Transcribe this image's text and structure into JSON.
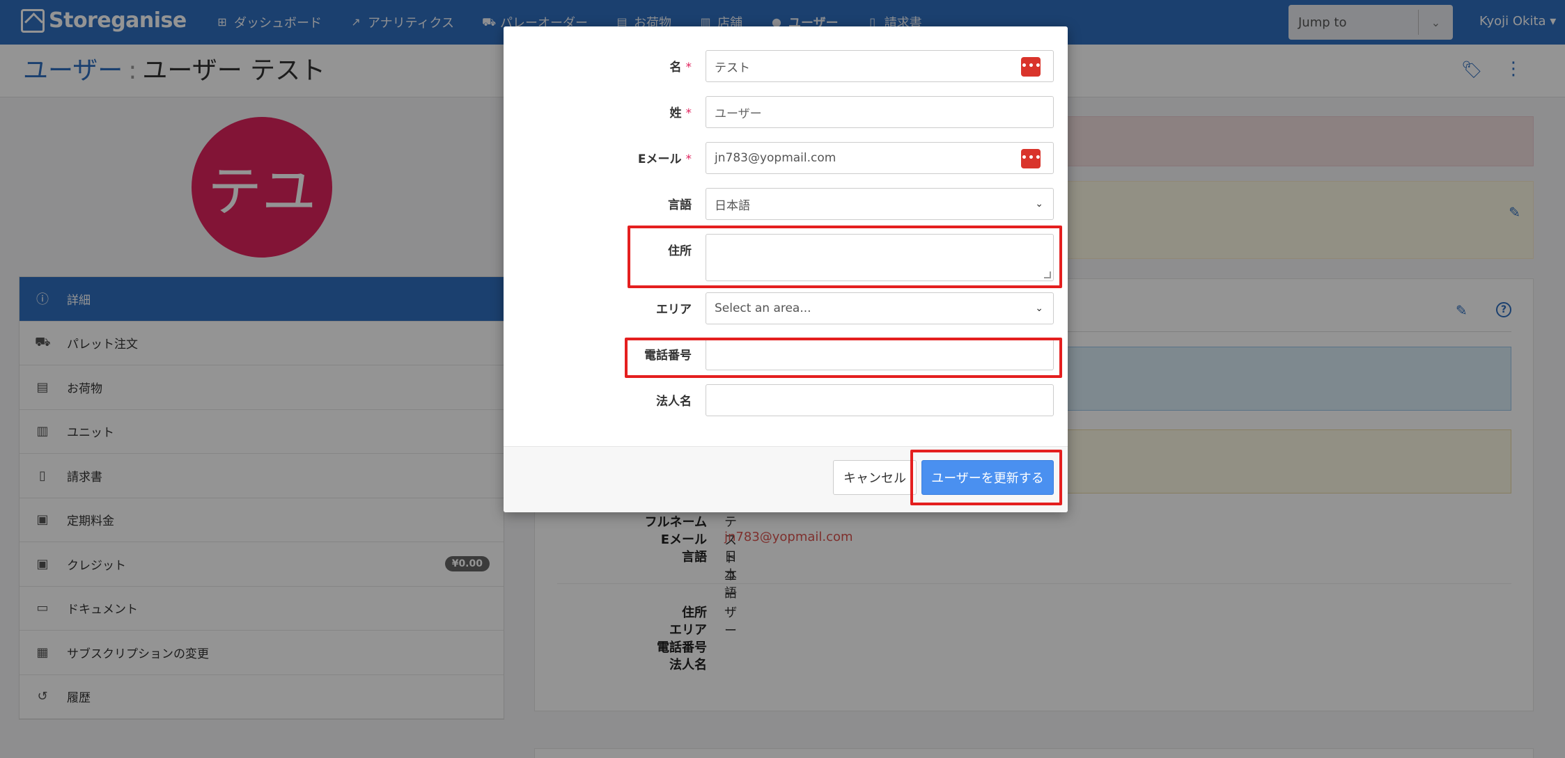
{
  "app": {
    "brand": "Storeganise"
  },
  "nav": {
    "items": [
      {
        "label": "ダッシュボード",
        "icon": "sitemap-icon"
      },
      {
        "label": "アナリティクス",
        "icon": "chart-icon"
      },
      {
        "label": "パレーオーダー",
        "icon": "truck-icon"
      },
      {
        "label": "お荷物",
        "icon": "box-icon"
      },
      {
        "label": "店舗",
        "icon": "building-icon"
      },
      {
        "label": "ユーザー",
        "icon": "user-icon"
      },
      {
        "label": "請求書",
        "icon": "invoice-icon"
      }
    ],
    "jump_to": "Jump to",
    "user": "Kyoji Okita"
  },
  "header": {
    "crumb_link": "ユーザー",
    "sep": ":",
    "title": "ユーザー テスト"
  },
  "avatar": {
    "initials": "テユ",
    "color": "#e0245e"
  },
  "sidebar": {
    "items": [
      {
        "label": "詳細",
        "icon": "info-icon",
        "active": true
      },
      {
        "label": "パレット注文",
        "icon": "truck-icon"
      },
      {
        "label": "お荷物",
        "icon": "archive-icon"
      },
      {
        "label": "ユニット",
        "icon": "building-icon"
      },
      {
        "label": "請求書",
        "icon": "invoice-icon"
      },
      {
        "label": "定期料金",
        "icon": "money-icon"
      },
      {
        "label": "クレジット",
        "icon": "money-icon",
        "badge": "¥0.00"
      },
      {
        "label": "ドキュメント",
        "icon": "document-icon"
      },
      {
        "label": "サブスクリプションの変更",
        "icon": "grid-icon"
      },
      {
        "label": "履歴",
        "icon": "history-icon"
      }
    ]
  },
  "details": {
    "fullname_label": "フルネーム",
    "fullname": "テスト ユーザー",
    "email_label": "Eメール",
    "email": "jn783@yopmail.com",
    "lang_label": "言語",
    "lang": "日本語",
    "address_label": "住所",
    "area_label": "エリア",
    "phone_label": "電話番号",
    "company_label": "法人名"
  },
  "modal": {
    "first_name": {
      "label": "名",
      "value": "テスト",
      "required": "*"
    },
    "last_name": {
      "label": "姓",
      "value": "",
      "placeholder": "ユーザー",
      "required": "*"
    },
    "email": {
      "label": "Eメール",
      "value": "jn783@yopmail.com",
      "required": "*"
    },
    "language": {
      "label": "言語",
      "value": "日本語"
    },
    "address": {
      "label": "住所",
      "value": ""
    },
    "area": {
      "label": "エリア",
      "placeholder": "Select an area..."
    },
    "phone": {
      "label": "電話番号",
      "value": ""
    },
    "company": {
      "label": "法人名",
      "value": ""
    },
    "cancel": "キャンセル",
    "submit": "ユーザーを更新する",
    "pw_icon": "•••|"
  },
  "colors": {
    "brand": "#2f6fc0",
    "primary_btn": "#4a90f0",
    "highlight": "#e41f1f",
    "required": "#e0245e"
  }
}
